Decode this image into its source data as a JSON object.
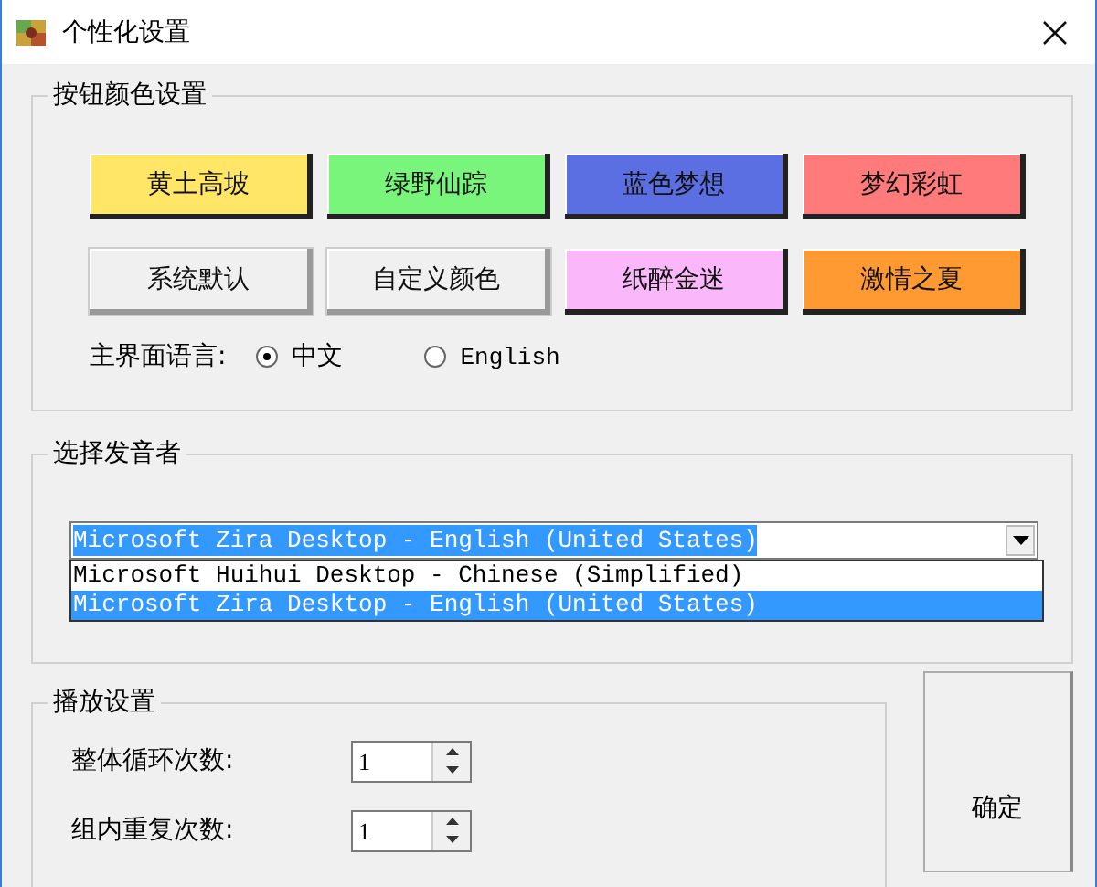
{
  "window": {
    "title": "个性化设置"
  },
  "button_colors": {
    "title": "按钮颜色设置",
    "buttons": [
      {
        "label": "黄土高坡",
        "color": "#ffe666"
      },
      {
        "label": "绿野仙踪",
        "color": "#78f57a"
      },
      {
        "label": "蓝色梦想",
        "color": "#5b6ee2"
      },
      {
        "label": "梦幻彩虹",
        "color": "#ff7a7a"
      },
      {
        "label": "系统默认",
        "color": "#f0f0f0"
      },
      {
        "label": "自定义颜色",
        "color": "#f0f0f0"
      },
      {
        "label": "纸醉金迷",
        "color": "#fab8fa"
      },
      {
        "label": "激情之夏",
        "color": "#ff9a33"
      }
    ],
    "language": {
      "label": "主界面语言:",
      "options": [
        {
          "label": "中文",
          "selected": true
        },
        {
          "label": "English",
          "selected": false
        }
      ]
    }
  },
  "voice": {
    "title": "选择发音者",
    "combo": {
      "value": "Microsoft Zira Desktop - English (United States)",
      "expanded": true,
      "options": [
        {
          "label": "Microsoft Huihui Desktop - Chinese (Simplified)",
          "selected": false
        },
        {
          "label": "Microsoft Zira Desktop - English (United States)",
          "selected": true
        }
      ]
    }
  },
  "playback": {
    "title": "播放设置",
    "fields": [
      {
        "label": "整体循环次数:",
        "value": "1"
      },
      {
        "label": "组内重复次数:",
        "value": "1"
      }
    ]
  },
  "confirm_button": "确定"
}
